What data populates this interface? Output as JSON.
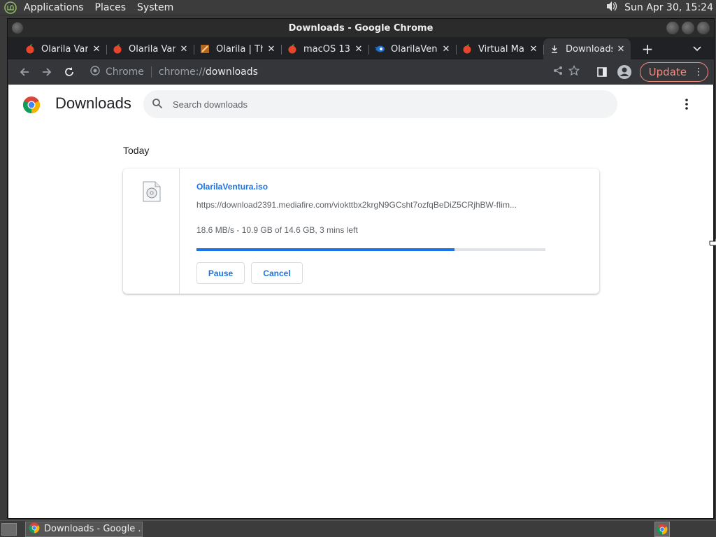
{
  "panel": {
    "menus": [
      "Applications",
      "Places",
      "System"
    ],
    "clock": "Sun Apr 30, 15:24"
  },
  "window": {
    "title": "Downloads - Google Chrome"
  },
  "tabs": [
    {
      "label": "Olarila Var",
      "icon": "apple-icon"
    },
    {
      "label": "Olarila Var",
      "icon": "apple-icon"
    },
    {
      "label": "Olarila | Th",
      "icon": "olarila-icon"
    },
    {
      "label": "macOS 13",
      "icon": "apple-icon"
    },
    {
      "label": "OlarilaVen",
      "icon": "mediafire-icon"
    },
    {
      "label": "Virtual Ma",
      "icon": "apple-icon"
    },
    {
      "label": "Downloads",
      "icon": "download-icon",
      "active": true
    }
  ],
  "toolbar": {
    "url_host": "Chrome",
    "url_scheme": "chrome://",
    "url_path": "downloads",
    "update_label": "Update"
  },
  "page": {
    "title": "Downloads",
    "search_placeholder": "Search downloads",
    "section": "Today",
    "download": {
      "filename": "OlarilaVentura.iso",
      "url": "https://download2391.mediafire.com/viokttbx2krgN9GCsht7ozfqBeDiZ5CRjhBW-fIim...",
      "status": "18.6 MB/s - 10.9 GB of 14.6 GB, 3 mins left",
      "progress_fraction": 0.74,
      "pause_label": "Pause",
      "cancel_label": "Cancel"
    }
  },
  "taskbar": {
    "task_label": "Downloads - Google ..."
  },
  "colors": {
    "accent": "#1a73e8",
    "update": "#f28b82"
  }
}
